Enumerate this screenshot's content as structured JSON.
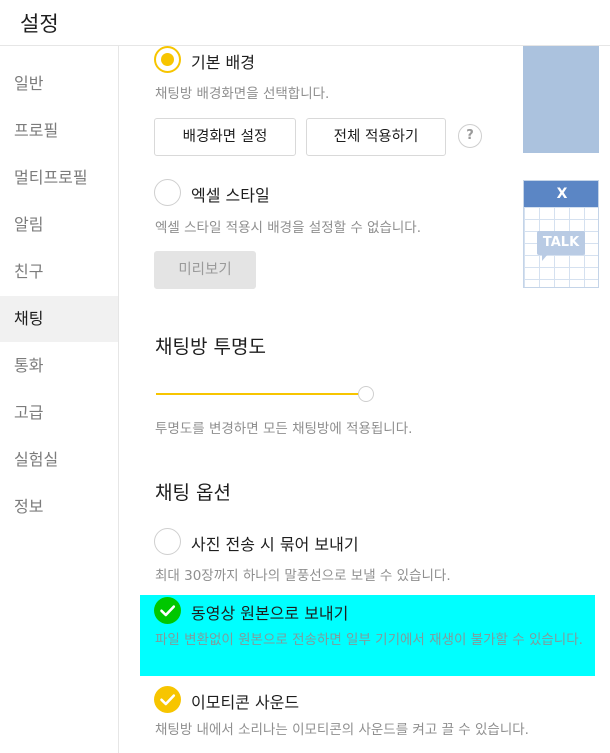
{
  "window": {
    "title": "설정"
  },
  "sidebar": {
    "items": [
      {
        "label": "일반"
      },
      {
        "label": "프로필"
      },
      {
        "label": "멀티프로필"
      },
      {
        "label": "알림"
      },
      {
        "label": "친구"
      },
      {
        "label": "채팅",
        "active": true
      },
      {
        "label": "통화"
      },
      {
        "label": "고급"
      },
      {
        "label": "실험실"
      },
      {
        "label": "정보"
      }
    ]
  },
  "background": {
    "default_option": {
      "label": "기본 배경",
      "selected": true,
      "description": "채팅방 배경화면을 선택합니다."
    },
    "set_wallpaper_button": "배경화면 설정",
    "apply_all_button": "전체 적용하기",
    "help_icon": "?",
    "excel_option": {
      "label": "엑셀 스타일",
      "selected": false,
      "description": "엑셀 스타일 적용시 배경을 설정할 수 없습니다."
    },
    "preview_button": "미리보기",
    "excel_thumbnail": {
      "header_glyph": "X",
      "badge": "TALK"
    }
  },
  "transparency": {
    "title": "채팅방 투명도",
    "level": 1.0,
    "description": "투명도를 변경하면 모든 채팅방에 적용됩니다."
  },
  "chat_options": {
    "title": "채팅 옵션",
    "items": [
      {
        "label": "사진 전송 시 묶어 보내기",
        "checked": false,
        "description": "최대 30장까지 하나의 말풍선으로 보낼 수 있습니다."
      },
      {
        "label": "동영상 원본으로 보내기",
        "checked": true,
        "description": "파일 변환없이 원본으로 전송하면 일부 기기에서 재생이 불가할 수 있습니다."
      },
      {
        "label": "이모티콘 사운드",
        "checked": true,
        "description": "채팅방 내에서 소리나는 이모티콘의 사운드를 켜고 끌 수 있습니다."
      }
    ]
  },
  "colors": {
    "accent": "#f7c500",
    "check_green": "#00c700",
    "highlight": "#00ffff"
  }
}
